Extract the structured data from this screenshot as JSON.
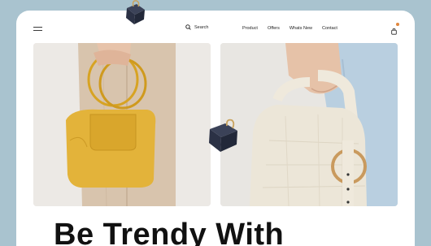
{
  "header": {
    "search_label": "Search",
    "nav": [
      "Product",
      "Offers",
      "Whats New",
      "Contact"
    ]
  },
  "hero": {
    "headline": "Be Trendy With"
  },
  "icons": {
    "menu": "hamburger-menu-icon",
    "search": "search-icon",
    "cart": "shopping-bag-icon",
    "decor": "gift-box-icon"
  },
  "colors": {
    "background": "#a9c3cf",
    "accent": "#e1873d",
    "yellow_bag": "#e3b33a",
    "white_bag": "#ece6d8",
    "cube": "#2b3145"
  }
}
